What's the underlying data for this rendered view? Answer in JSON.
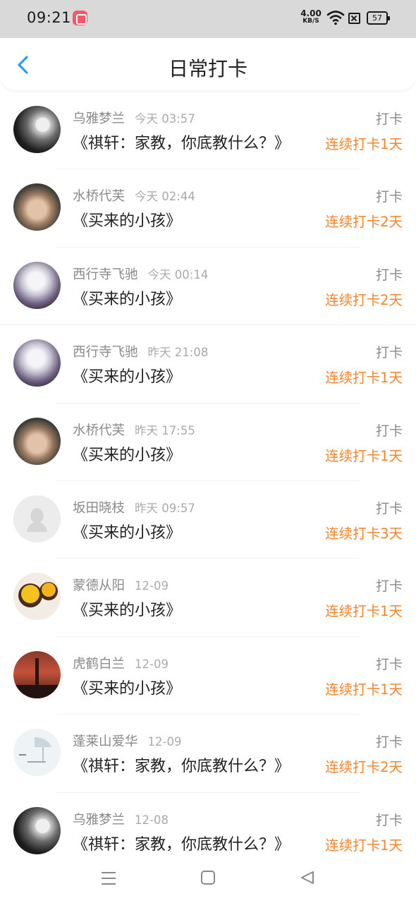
{
  "status_bar": {
    "time": "09:21",
    "net_speed_value": "4.00",
    "net_speed_unit": "KB/S",
    "battery": "57",
    "icons": [
      "app-notification-icon",
      "wifi-icon",
      "sim-disabled-icon",
      "battery-icon"
    ]
  },
  "header": {
    "title": "日常打卡",
    "back_icon": "chevron-left-icon",
    "accent_color": "#2b9cf0"
  },
  "colors": {
    "streak": "#f5842a",
    "secondary_text": "#8a8a8a"
  },
  "feed": {
    "items": [
      {
        "user": "乌雅梦兰",
        "time": "今天 03:57",
        "book": "《祺轩：家教，你底教什么？》",
        "action": "打卡",
        "streak": "连续打卡1天",
        "avatar": "bw-woman-avatar"
      },
      {
        "user": "水桥代芙",
        "time": "今天 02:44",
        "book": "《买来的小孩》",
        "action": "打卡",
        "streak": "连续打卡2天",
        "avatar": "young-man-avatar"
      },
      {
        "user": "西行寺飞驰",
        "time": "今天 00:14",
        "book": "《买来的小孩》",
        "action": "打卡",
        "streak": "连续打卡2天",
        "avatar": "anime-character-avatar"
      },
      {
        "user": "西行寺飞驰",
        "time": "昨天 21:08",
        "book": "《买来的小孩》",
        "action": "打卡",
        "streak": "连续打卡1天",
        "avatar": "anime-character-avatar"
      },
      {
        "user": "水桥代芙",
        "time": "昨天 17:55",
        "book": "《买来的小孩》",
        "action": "打卡",
        "streak": "连续打卡1天",
        "avatar": "young-man-avatar"
      },
      {
        "user": "坂田晓枝",
        "time": "昨天 09:57",
        "book": "《买来的小孩》",
        "action": "打卡",
        "streak": "连续打卡3天",
        "avatar": "default-avatar"
      },
      {
        "user": "蒙德从阳",
        "time": "12-09",
        "book": "《买来的小孩》",
        "action": "打卡",
        "streak": "连续打卡1天",
        "avatar": "dessert-avatar"
      },
      {
        "user": "虎鹤白兰",
        "time": "12-09",
        "book": "《买来的小孩》",
        "action": "打卡",
        "streak": "连续打卡1天",
        "avatar": "city-night-avatar"
      },
      {
        "user": "蓬莱山爱华",
        "time": "12-09",
        "book": "《祺轩：家教，你底教什么？》",
        "action": "打卡",
        "streak": "连续打卡2天",
        "avatar": "umbrella-illustration-avatar"
      },
      {
        "user": "乌雅梦兰",
        "time": "12-08",
        "book": "《祺轩：家教，你底教什么？》",
        "action": "打卡",
        "streak": "连续打卡1天",
        "avatar": "bw-woman-avatar"
      }
    ]
  },
  "bottom_nav": {
    "icons": [
      "menu-icon",
      "home-square-icon",
      "back-triangle-icon"
    ]
  }
}
